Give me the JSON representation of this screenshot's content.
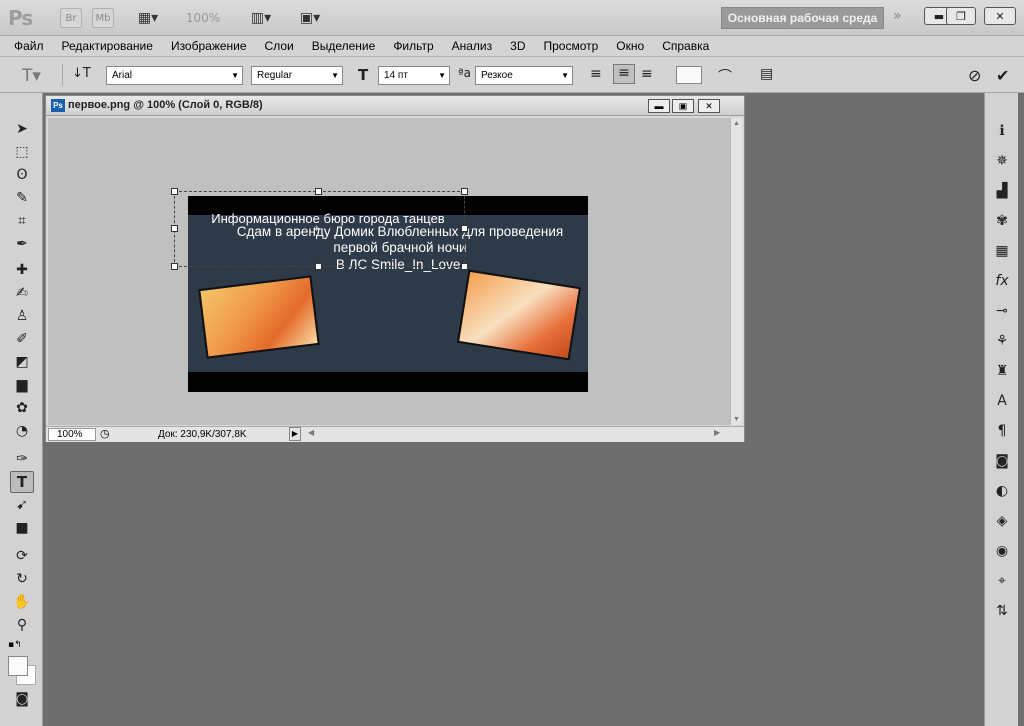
{
  "app": {
    "logo": "Ps",
    "quick_buttons": [
      "Br",
      "Mb",
      "100%"
    ],
    "workspace_label": "Основная рабочая среда",
    "window_controls": [
      "minimize",
      "restore",
      "close"
    ]
  },
  "menu": [
    "Файл",
    "Редактирование",
    "Изображение",
    "Слои",
    "Выделение",
    "Фильтр",
    "Анализ",
    "3D",
    "Просмотр",
    "Окно",
    "Справка"
  ],
  "options": {
    "font_family": "Arial",
    "font_style": "Regular",
    "font_size": "14 пт",
    "antialias": "Резкое",
    "tool_icon": "text-tool-icon"
  },
  "document": {
    "title": "первое.png @ 100% (Слой 0, RGB/8)",
    "zoom": "100%",
    "doc_info": "Док: 230,9K/307,8K",
    "image_text": {
      "line1": "Информационное бюро города танцев",
      "line2": "Сдам в аренду Домик Влюбленных для проведения",
      "line3": "первой брачной ночи",
      "line4": "В ЛС Smile_In_Love."
    }
  },
  "colors": {
    "accent_active": "#bcbcbc",
    "workspace_btn": "#9a9a9a",
    "background": "#6e6e6e"
  }
}
